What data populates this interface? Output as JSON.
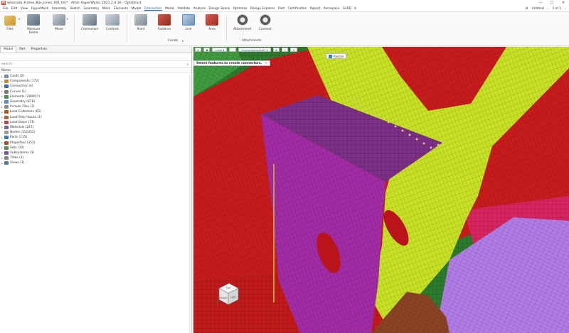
{
  "window": {
    "logo": "H",
    "title": "Silverado_Frame_Box_Lines_001.hm* - Altair HyperWorks 2021.2.0.30 - OptiStruct",
    "controls": [
      "—",
      "□",
      "✕"
    ]
  },
  "menubar": {
    "items": [
      "File",
      "Edit",
      "View",
      "HyperMesh",
      "Assembly",
      "Sketch",
      "Geometry",
      "Mesh",
      "Elements",
      "Morph",
      "Connectors",
      "Model",
      "Validate",
      "Analyze",
      "Design Space",
      "Optimize",
      "Design Explorer",
      "Post",
      "Certification",
      "Report",
      "Aerospace",
      "SnRD"
    ],
    "active": "Connectors",
    "right_items": [
      "Untitled",
      "1 of 1"
    ]
  },
  "ribbon": {
    "tools": {
      "files": "Files",
      "measure": [
        "Measure",
        "Home"
      ],
      "move": "Move",
      "connectors": "Connectors",
      "controls": "Controls",
      "point": "Point",
      "fastener": "Fastener",
      "line": "Line",
      "area": "Area",
      "attachment": "Attachment",
      "connect": "Connect"
    },
    "groups": {
      "create": "Create",
      "attachments": "Attachments"
    }
  },
  "left_panel": {
    "tabs": [
      "Model",
      "Part",
      "Properties"
    ],
    "active_tab": "Model",
    "search_placeholder": "Search",
    "column_header": "Name",
    "tree": [
      {
        "label": "Cards  (2)",
        "color": "#7c8ea3"
      },
      {
        "label": "Components  (172)",
        "color": "#c8893a"
      },
      {
        "label": "Connectors  (4)",
        "color": "#3a6bb0"
      },
      {
        "label": "Curves  (1)",
        "color": "#7a7a7a"
      },
      {
        "label": "Elements  (299917)",
        "color": "#4e8f4e"
      },
      {
        "label": "Geometry  (879)",
        "color": "#5d8fc5"
      },
      {
        "label": "Include Files  (2)",
        "color": "#8a8a8a"
      },
      {
        "label": "Load Collectors  (61)",
        "color": "#b05a2a"
      },
      {
        "label": "Load Step Inputs  (1)",
        "color": "#9a6a3a"
      },
      {
        "label": "Load Steps  (31)",
        "color": "#b24a4a"
      },
      {
        "label": "Materials  (247)",
        "color": "#6a6a9a"
      },
      {
        "label": "Nodes  (311452)",
        "color": "#999999"
      },
      {
        "label": "Parts  (115)",
        "color": "#3a7ab0"
      },
      {
        "label": "Properties  (352)",
        "color": "#a0522d"
      },
      {
        "label": "Sets  (10)",
        "color": "#5a8a5a"
      },
      {
        "label": "Subsystems  (1)",
        "color": "#7a5a9a"
      },
      {
        "label": "Titles  (1)",
        "color": "#888888"
      },
      {
        "label": "Views  (1)",
        "color": "#5a7a9a"
      }
    ]
  },
  "viewport": {
    "toolbar": {
      "delete_btn": "✖",
      "lines_combo": "Lines",
      "connector_combo": "connectorcontrol1",
      "realize_label": "Realize"
    },
    "selection_message": "Select features to create connectors.",
    "close_glyph": "✕",
    "view_cube_faces": [
      "TOP",
      "FRONT",
      "LEFT"
    ]
  }
}
